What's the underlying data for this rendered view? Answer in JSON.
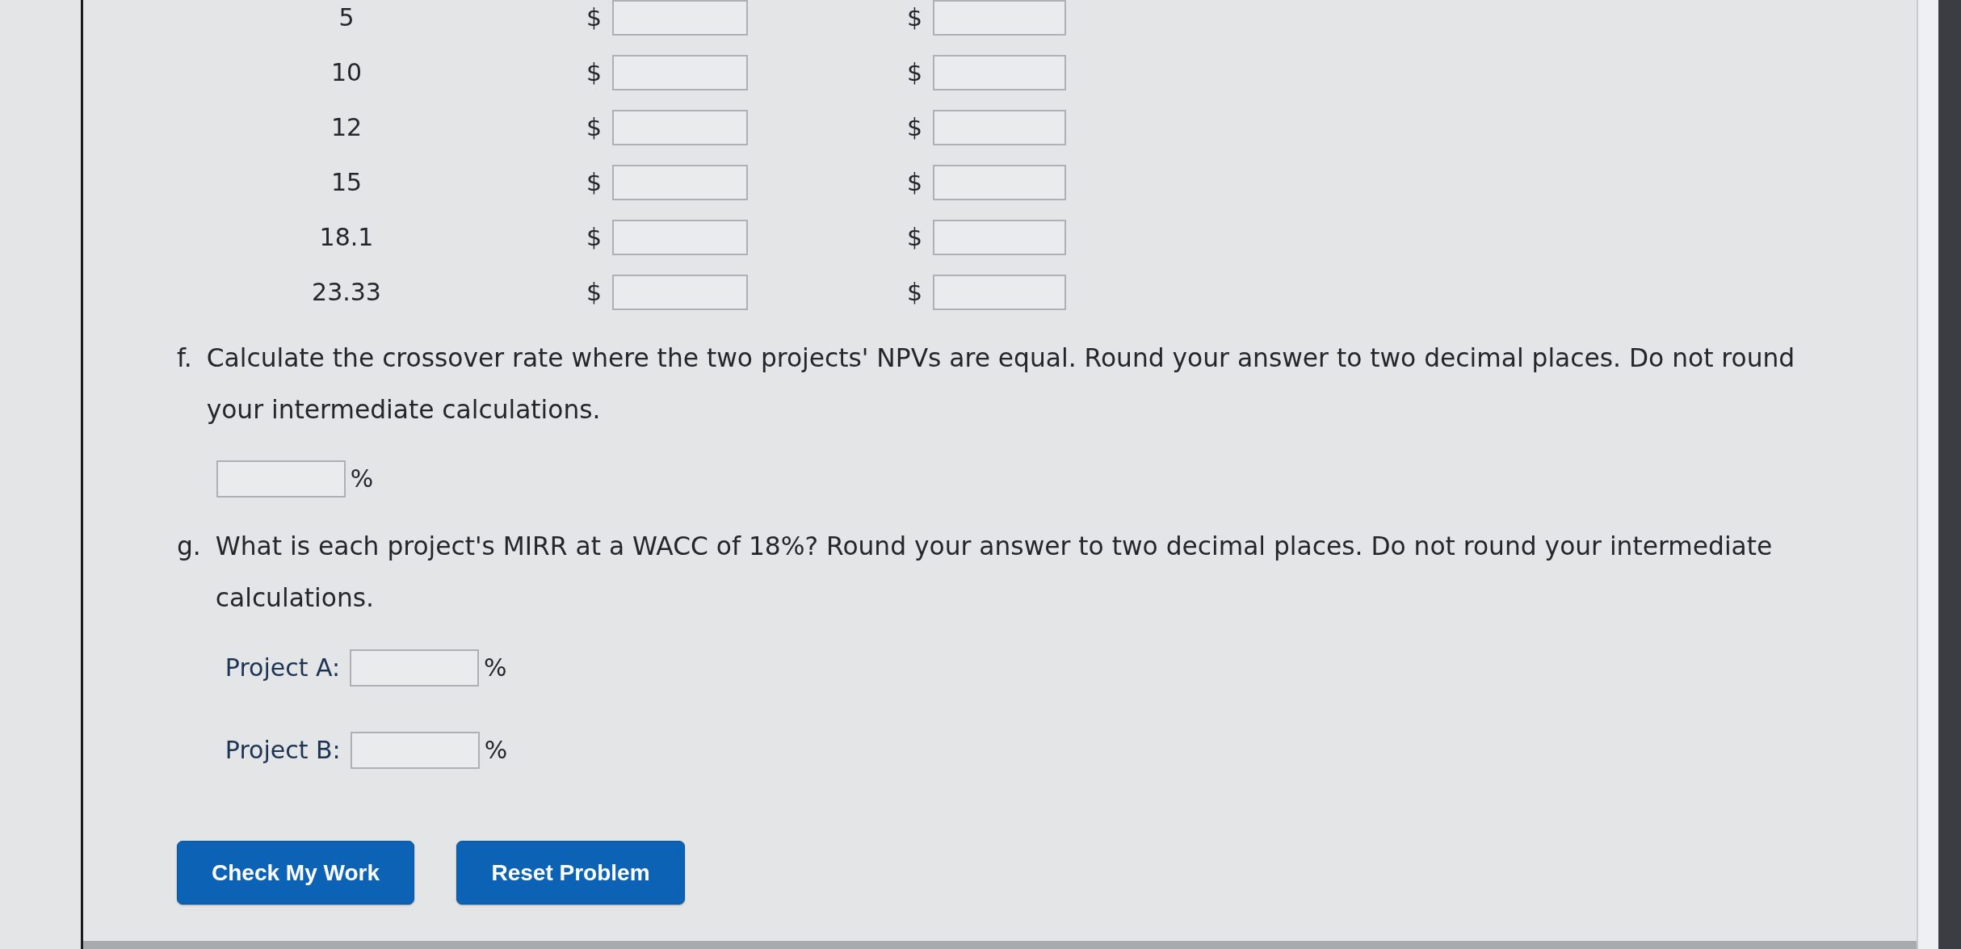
{
  "table": {
    "rows": [
      {
        "rate": "5",
        "cells": [
          {
            "prefix": "$"
          },
          {
            "prefix": "$"
          }
        ]
      },
      {
        "rate": "10",
        "cells": [
          {
            "prefix": "$"
          },
          {
            "prefix": "$"
          }
        ]
      },
      {
        "rate": "12",
        "cells": [
          {
            "prefix": "$"
          },
          {
            "prefix": "$"
          }
        ]
      },
      {
        "rate": "15",
        "cells": [
          {
            "prefix": "$"
          },
          {
            "prefix": "$"
          }
        ]
      },
      {
        "rate": "18.1",
        "cells": [
          {
            "prefix": "$"
          },
          {
            "prefix": "$"
          }
        ]
      },
      {
        "rate": "23.33",
        "cells": [
          {
            "prefix": "$"
          },
          {
            "prefix": "$"
          }
        ]
      }
    ]
  },
  "questions": [
    {
      "label": "f.",
      "text": "Calculate the crossover rate where the two projects' NPVs are equal. Round your answer to two decimal places. Do not round your intermediate calculations.",
      "answers": [
        {
          "suffix": "%"
        }
      ]
    },
    {
      "label": "g.",
      "text": "What is each project's MIRR at a WACC of 18%? Round your answer to two decimal places. Do not round your intermediate calculations.",
      "answers": [
        {
          "label": "Project A:",
          "suffix": "%"
        },
        {
          "label": "Project B:",
          "suffix": "%"
        }
      ]
    }
  ],
  "buttons": [
    "Check My Work",
    "Reset Problem"
  ]
}
